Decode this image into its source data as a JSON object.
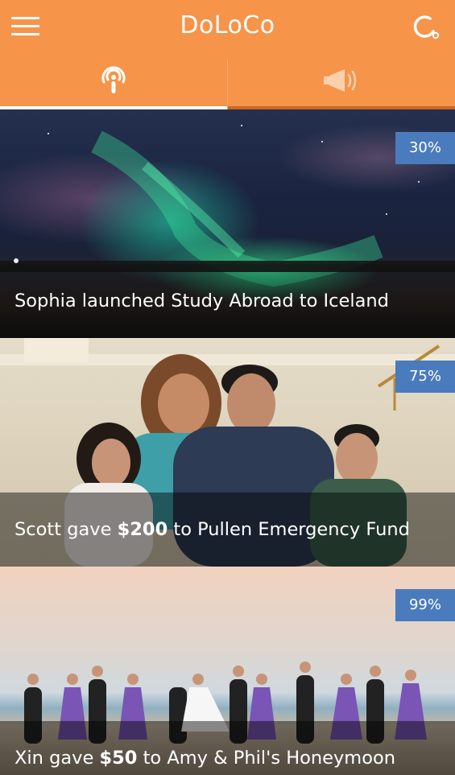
{
  "header": {
    "title": "DoLoCo",
    "menu_icon": "hamburger-menu-icon",
    "refresh_icon": "refresh-icon"
  },
  "tabs": [
    {
      "icon": "broadcast-icon",
      "active": true
    },
    {
      "icon": "megaphone-icon",
      "active": false
    }
  ],
  "colors": {
    "header_bg": "#F6944A",
    "badge_bg": "#4A7BBD",
    "active_tab_underline": "#FFFFFF",
    "inactive_tab_underline": "#C56A27"
  },
  "feed": [
    {
      "percent": "30%",
      "caption": "Sophia launched Study Abroad to Iceland",
      "image": "northern-lights-over-iceland"
    },
    {
      "percent": "75%",
      "caption_pre": "Scott gave ",
      "amount": "$200",
      "caption_post": " to Pullen Emergency Fund",
      "image": "family-portrait"
    },
    {
      "percent": "99%",
      "caption_pre": "Xin gave ",
      "amount": "$50",
      "caption_post": " to Amy & Phil's Honeymoon",
      "image": "wedding-party-on-beach"
    }
  ]
}
